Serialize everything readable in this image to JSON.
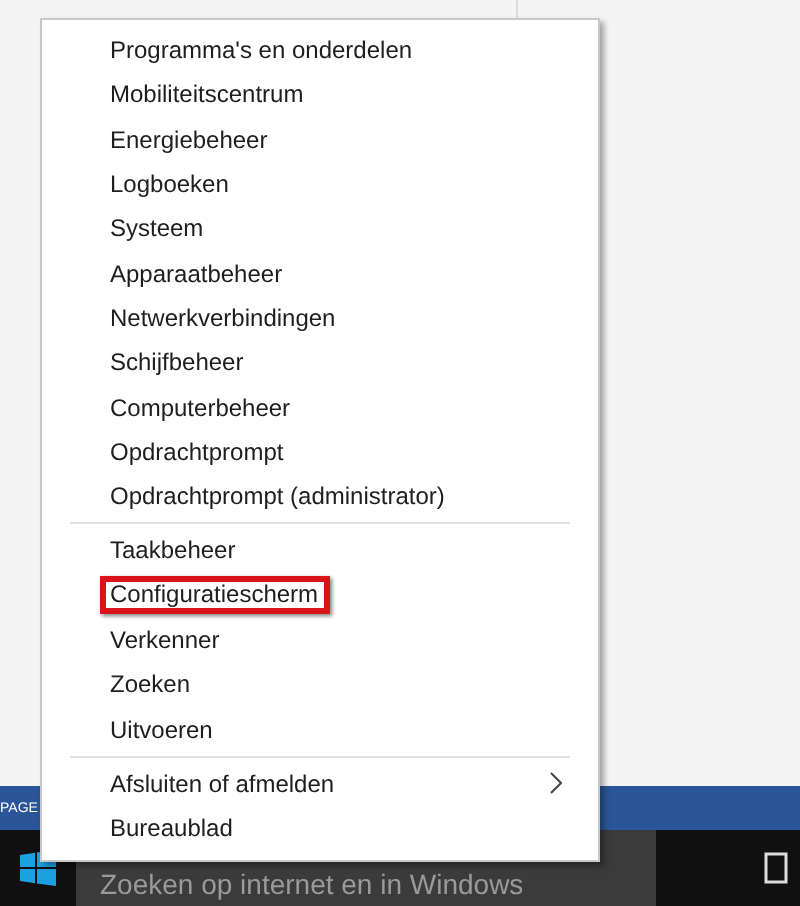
{
  "background_bar": {
    "label": "PAGE"
  },
  "taskbar": {
    "search": {
      "placeholder": "Zoeken op internet en in Windows"
    }
  },
  "menu": {
    "groups": [
      {
        "items": [
          {
            "label": "Programma's en onderdelen",
            "marked": false,
            "submenu": false
          },
          {
            "label": "Mobiliteitscentrum",
            "marked": false,
            "submenu": false
          },
          {
            "label": "Energiebeheer",
            "marked": false,
            "submenu": false
          },
          {
            "label": "Logboeken",
            "marked": false,
            "submenu": false
          },
          {
            "label": "Systeem",
            "marked": false,
            "submenu": false
          },
          {
            "label": "Apparaatbeheer",
            "marked": false,
            "submenu": false
          },
          {
            "label": "Netwerkverbindingen",
            "marked": false,
            "submenu": false
          },
          {
            "label": "Schijfbeheer",
            "marked": false,
            "submenu": false
          },
          {
            "label": "Computerbeheer",
            "marked": false,
            "submenu": false
          },
          {
            "label": "Opdrachtprompt",
            "marked": false,
            "submenu": false
          },
          {
            "label": "Opdrachtprompt (administrator)",
            "marked": false,
            "submenu": false
          }
        ]
      },
      {
        "items": [
          {
            "label": "Taakbeheer",
            "marked": false,
            "submenu": false
          },
          {
            "label": "Configuratiescherm",
            "marked": true,
            "submenu": false
          },
          {
            "label": "Verkenner",
            "marked": false,
            "submenu": false
          },
          {
            "label": "Zoeken",
            "marked": false,
            "submenu": false
          },
          {
            "label": "Uitvoeren",
            "marked": false,
            "submenu": false
          }
        ]
      },
      {
        "items": [
          {
            "label": "Afsluiten of afmelden",
            "marked": false,
            "submenu": true
          },
          {
            "label": "Bureaublad",
            "marked": false,
            "submenu": false
          }
        ]
      }
    ]
  }
}
